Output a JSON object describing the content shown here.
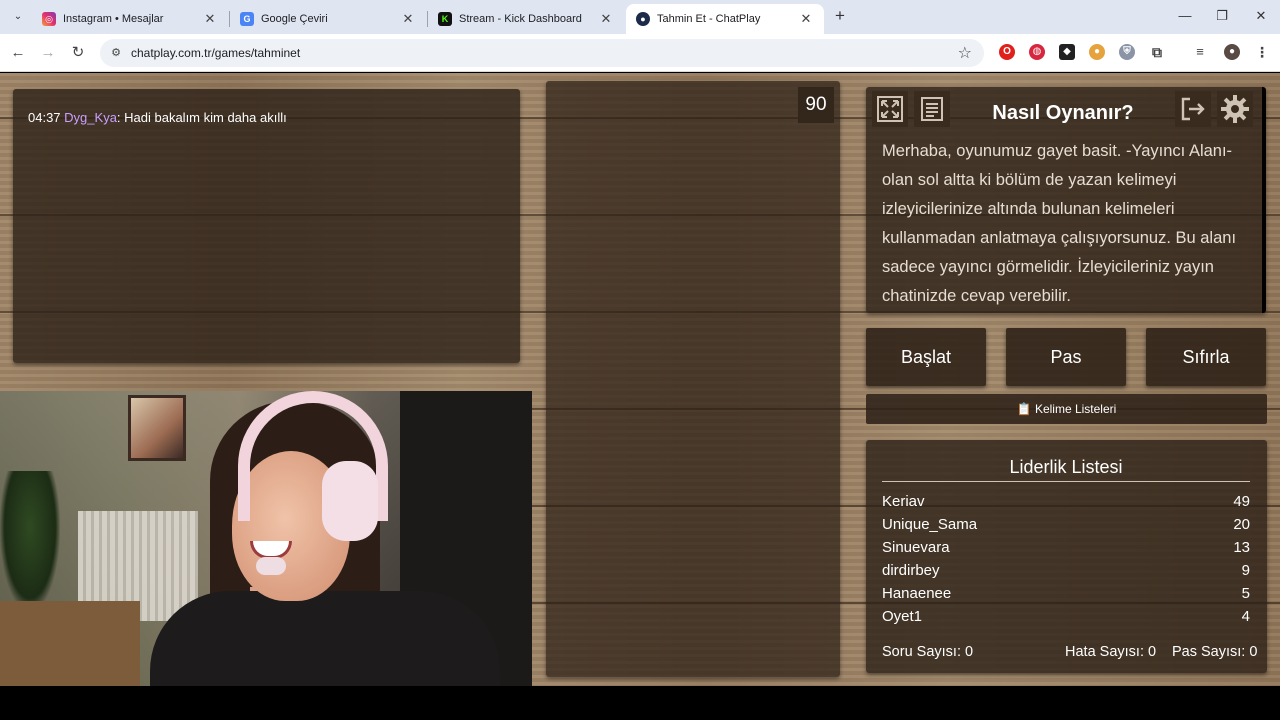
{
  "browser": {
    "tabs": [
      {
        "title": "Instagram • Mesajlar",
        "icon": "instagram-icon"
      },
      {
        "title": "Google Çeviri",
        "icon": "google-translate-icon"
      },
      {
        "title": "Stream - Kick Dashboard",
        "icon": "kick-icon"
      },
      {
        "title": "Tahmin Et - ChatPlay",
        "icon": "chatplay-icon"
      }
    ],
    "url": "chatplay.com.tr/games/tahminet"
  },
  "chat": {
    "time": "04:37",
    "user": "Dyg_Kya",
    "message": ": Hadi bakalım kim daha akıllı"
  },
  "timer": "90",
  "howto": {
    "title": "Nasıl Oynanır?",
    "text": "Merhaba, oyunumuz gayet basit. -Yayıncı Alanı- olan sol altta ki bölüm de yazan kelimeyi izleyicilerinize altında bulunan kelimeleri kullanmadan anlatmaya çalışıyorsunuz. Bu alanı sadece yayıncı görmelidir. İzleyicileriniz yayın chatinizde cevap verebilir."
  },
  "controls": {
    "start": "Başlat",
    "pass": "Pas",
    "reset": "Sıfırla",
    "word_lists": "📋 Kelime Listeleri"
  },
  "leaderboard": {
    "title": "Liderlik Listesi",
    "rows": [
      {
        "name": "Keriav",
        "score": "49"
      },
      {
        "name": "Unique_Sama",
        "score": "20"
      },
      {
        "name": "Sinuevara",
        "score": "13"
      },
      {
        "name": "dirdirbey",
        "score": "9"
      },
      {
        "name": "Hanaenee",
        "score": "5"
      },
      {
        "name": "Oyet1",
        "score": "4"
      }
    ],
    "stats": {
      "questions": "Soru Sayısı: 0",
      "errors": "Hata Sayısı: 0",
      "passes": "Pas Sayısı: 0"
    }
  },
  "colors": {
    "panel": "#2c2016",
    "chat_user": "#c9a0ff",
    "wood": "#a08668"
  }
}
